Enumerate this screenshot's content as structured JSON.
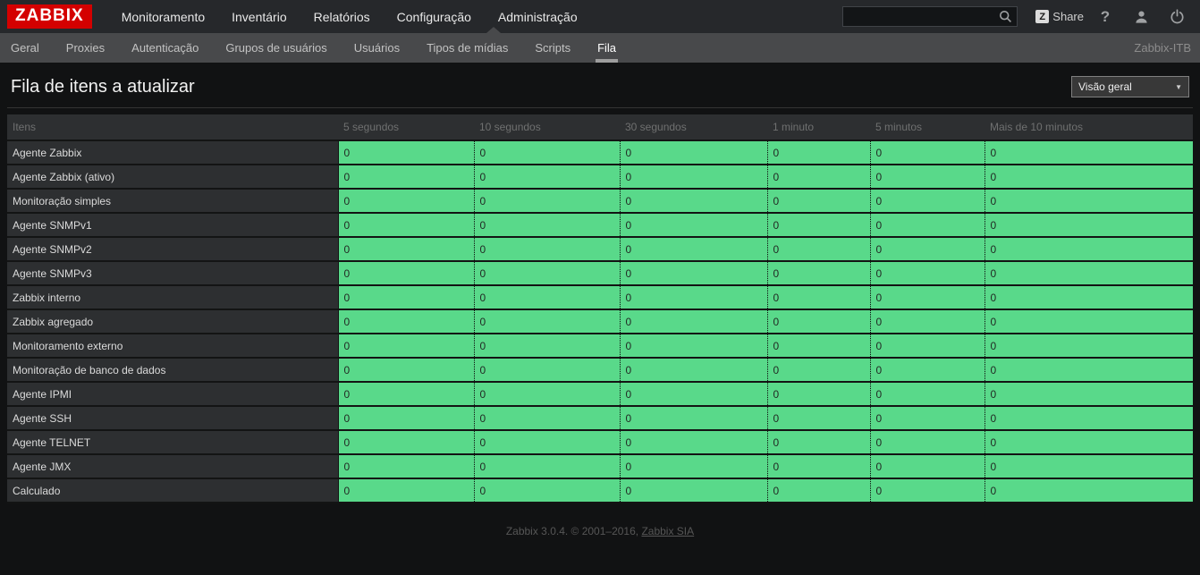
{
  "brand": {
    "logo_text": "ZABBIX",
    "logo_bg": "#d40000"
  },
  "top_nav": {
    "items": [
      "Monitoramento",
      "Inventário",
      "Relatórios",
      "Configuração",
      "Administração"
    ],
    "active": "Administração"
  },
  "search": {
    "value": "",
    "placeholder": ""
  },
  "top_actions": {
    "share_badge": "Z",
    "share_label": "Share",
    "help_label": "?"
  },
  "sub_nav": {
    "items": [
      "Geral",
      "Proxies",
      "Autenticação",
      "Grupos de usuários",
      "Usuários",
      "Tipos de mídias",
      "Scripts",
      "Fila"
    ],
    "active": "Fila",
    "context": "Zabbix-ITB"
  },
  "page": {
    "title": "Fila de itens a atualizar",
    "view_select_value": "Visão geral",
    "view_select_arrow": "▼"
  },
  "table": {
    "headers": [
      "Itens",
      "5 segundos",
      "10 segundos",
      "30 segundos",
      "1 minuto",
      "5 minutos",
      "Mais de 10 minutos"
    ],
    "rows": [
      {
        "item": "Agente Zabbix",
        "values": [
          "0",
          "0",
          "0",
          "0",
          "0",
          "0"
        ]
      },
      {
        "item": "Agente Zabbix (ativo)",
        "values": [
          "0",
          "0",
          "0",
          "0",
          "0",
          "0"
        ]
      },
      {
        "item": "Monitoração simples",
        "values": [
          "0",
          "0",
          "0",
          "0",
          "0",
          "0"
        ]
      },
      {
        "item": "Agente SNMPv1",
        "values": [
          "0",
          "0",
          "0",
          "0",
          "0",
          "0"
        ]
      },
      {
        "item": "Agente SNMPv2",
        "values": [
          "0",
          "0",
          "0",
          "0",
          "0",
          "0"
        ]
      },
      {
        "item": "Agente SNMPv3",
        "values": [
          "0",
          "0",
          "0",
          "0",
          "0",
          "0"
        ]
      },
      {
        "item": "Zabbix interno",
        "values": [
          "0",
          "0",
          "0",
          "0",
          "0",
          "0"
        ]
      },
      {
        "item": "Zabbix agregado",
        "values": [
          "0",
          "0",
          "0",
          "0",
          "0",
          "0"
        ]
      },
      {
        "item": "Monitoramento externo",
        "values": [
          "0",
          "0",
          "0",
          "0",
          "0",
          "0"
        ]
      },
      {
        "item": "Monitoração de banco de dados",
        "values": [
          "0",
          "0",
          "0",
          "0",
          "0",
          "0"
        ]
      },
      {
        "item": "Agente IPMI",
        "values": [
          "0",
          "0",
          "0",
          "0",
          "0",
          "0"
        ]
      },
      {
        "item": "Agente SSH",
        "values": [
          "0",
          "0",
          "0",
          "0",
          "0",
          "0"
        ]
      },
      {
        "item": "Agente TELNET",
        "values": [
          "0",
          "0",
          "0",
          "0",
          "0",
          "0"
        ]
      },
      {
        "item": "Agente JMX",
        "values": [
          "0",
          "0",
          "0",
          "0",
          "0",
          "0"
        ]
      },
      {
        "item": "Calculado",
        "values": [
          "0",
          "0",
          "0",
          "0",
          "0",
          "0"
        ]
      }
    ]
  },
  "footer": {
    "text_prefix": "Zabbix 3.0.4. © 2001–2016, ",
    "link_label": "Zabbix SIA"
  },
  "colors": {
    "ok_green": "#59d98a",
    "logo_red": "#d40000",
    "top_bar_bg": "#26282b",
    "sub_bar_bg": "#48494b",
    "page_bg": "#111213",
    "cell_dark_bg": "#2d2f31"
  }
}
